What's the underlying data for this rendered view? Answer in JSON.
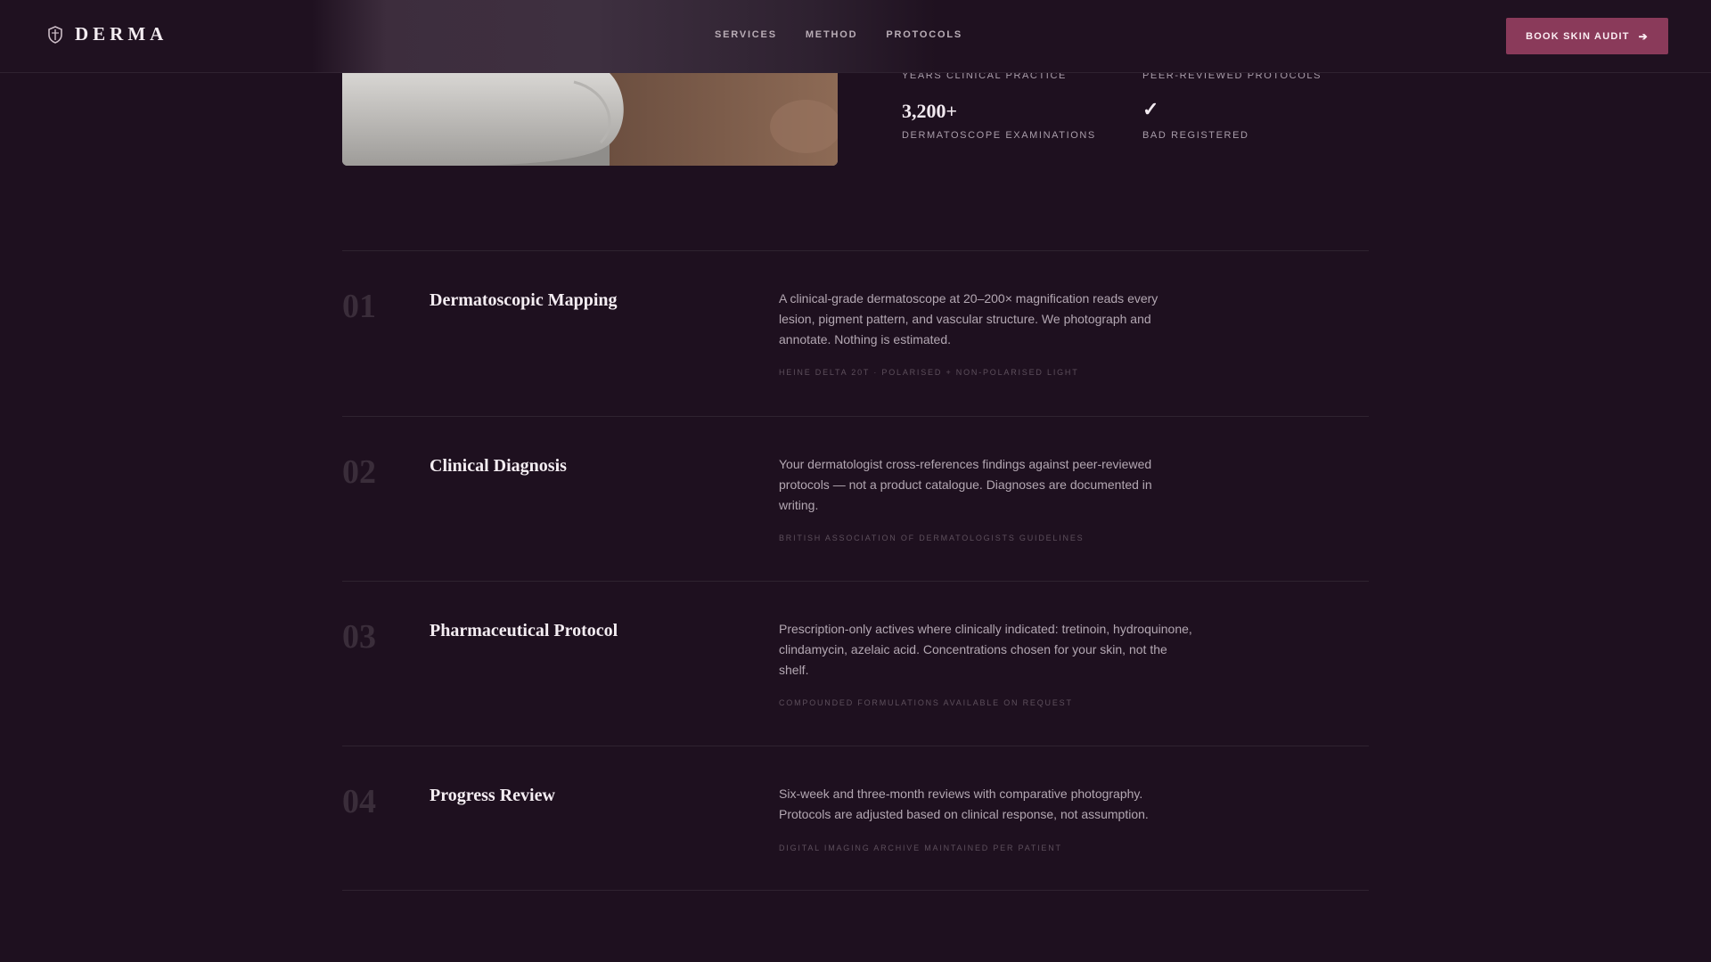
{
  "header": {
    "brand": "DERMA",
    "brand_icon": "shield-icon",
    "nav": [
      "SERVICES",
      "METHOD",
      "PROTOCOLS"
    ],
    "cta_label": "BOOK SKIN AUDIT",
    "cta_icon": "arrow-right-icon",
    "accent_color": "#8a3a5a"
  },
  "stats": [
    {
      "value": "",
      "label": "YEARS CLINICAL PRACTICE"
    },
    {
      "value": "",
      "label": "PEER-REVIEWED PROTOCOLS"
    },
    {
      "value": "3,200+",
      "label": "DERMATOSCOPE EXAMINATIONS"
    },
    {
      "value": "✓",
      "label": "BAD REGISTERED"
    }
  ],
  "steps": [
    {
      "number": "01",
      "title": "Dermatoscopic Mapping",
      "desc_lines": [
        "A clinical-grade dermatoscope at 20–200× magnification reads every",
        "lesion, pigment pattern, and vascular structure. We photograph and",
        "annotate. Nothing is estimated."
      ],
      "note": "HEINE DELTA 20T · POLARISED + NON-POLARISED LIGHT"
    },
    {
      "number": "02",
      "title": "Clinical Diagnosis",
      "desc_lines": [
        "Your dermatologist cross-references findings against peer-reviewed",
        "protocols — not a product catalogue. Diagnoses are documented in",
        "writing."
      ],
      "note": "BRITISH ASSOCIATION OF DERMATOLOGISTS GUIDELINES"
    },
    {
      "number": "03",
      "title": "Pharmaceutical Protocol",
      "desc_lines": [
        "Prescription-only actives where clinically indicated: tretinoin, hydroquinone,",
        "clindamycin, azelaic acid. Concentrations chosen for your skin, not the",
        "shelf."
      ],
      "note": "COMPOUNDED FORMULATIONS AVAILABLE ON REQUEST"
    },
    {
      "number": "04",
      "title": "Progress Review",
      "desc_lines": [
        "Six-week and three-month reviews with comparative photography.",
        "Protocols are adjusted based on clinical response, not assumption."
      ],
      "note": "DIGITAL IMAGING ARCHIVE MAINTAINED PER PATIENT"
    }
  ]
}
